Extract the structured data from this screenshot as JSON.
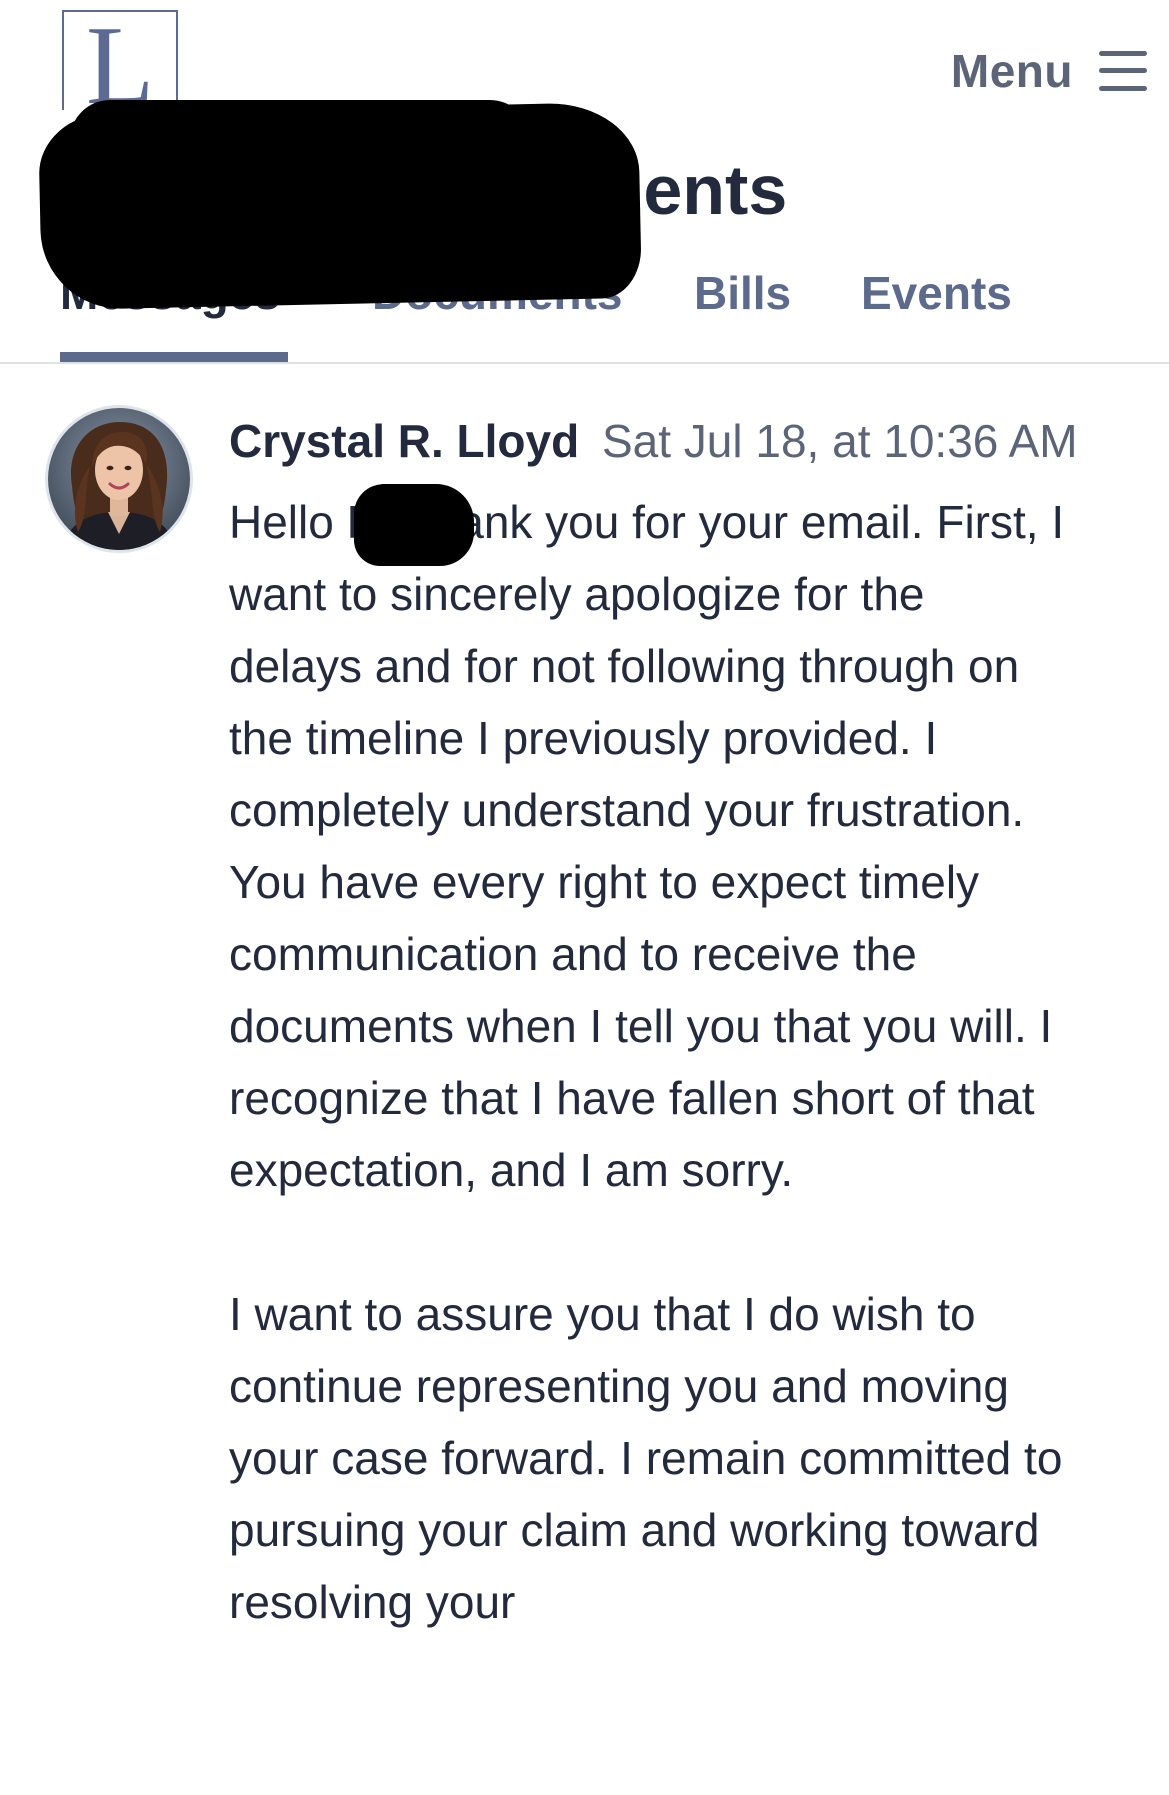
{
  "header": {
    "logo_letter": "L",
    "firm_name": "Messages Documents",
    "menu_label": "Menu",
    "menu_icon": "hamburger-icon"
  },
  "tabs": [
    {
      "label": "Messages",
      "active": true
    },
    {
      "label": "Documents",
      "active": false
    },
    {
      "label": "Bills",
      "active": false
    },
    {
      "label": "Events",
      "active": false
    }
  ],
  "message": {
    "sender": "Crystal R. Lloyd",
    "timestamp": "Sat Jul 18, at 10:36 AM",
    "avatar": "avatar-photo",
    "paragraphs": [
      "Hello R. Thank you for your email. First, I want to sincerely apologize for the delays and for not following through on the timeline I previously provided. I completely understand your frustration. You have every right to expect timely communication and to receive the documents when I tell you that you will. I recognize that I have fallen short of that expectation, and I am sorry.",
      "I want to assure you that I do wish to continue representing you and moving your case forward. I remain committed to pursuing your claim and working toward resolving your"
    ]
  },
  "colors": {
    "text_primary": "#232a3d",
    "text_secondary": "#5c6578",
    "tab_color": "#5c6a8c",
    "logo_color": "#5d6a94",
    "divider": "#dde1e7",
    "redaction": "#000000"
  }
}
